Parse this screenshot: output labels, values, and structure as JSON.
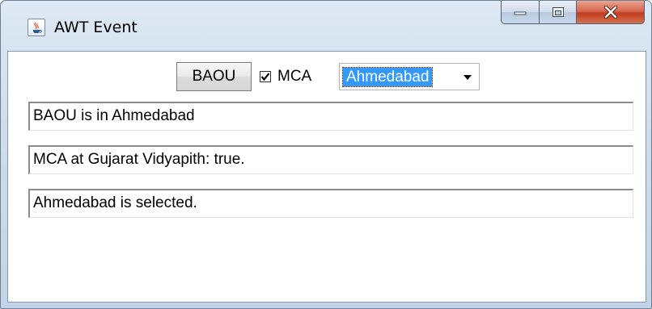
{
  "window": {
    "title": "AWT Event",
    "icon": "java-cup-icon"
  },
  "caption": {
    "minimize_icon": "minimize-icon",
    "maximize_icon": "maximize-icon",
    "close_icon": "close-icon"
  },
  "controls": {
    "button_label": "BAOU",
    "checkbox": {
      "label": "MCA",
      "checked": true
    },
    "choice": {
      "selected": "Ahmedabad"
    }
  },
  "fields": [
    {
      "value": "BAOU is in Ahmedabad"
    },
    {
      "value": "MCA at Gujarat Vidyapith: true."
    },
    {
      "value": "Ahmedabad is selected."
    }
  ],
  "colors": {
    "selection": "#3399ff",
    "close_button": "#c94a30"
  }
}
